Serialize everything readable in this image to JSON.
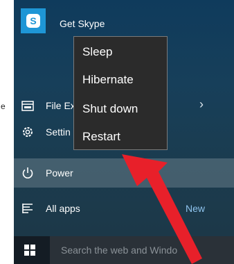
{
  "left_edge_text": "e",
  "start_menu": {
    "skype": {
      "icon_letter": "S",
      "label": "Get Skype"
    },
    "items": [
      {
        "key": "file_explorer",
        "label": "File Ex",
        "icon": "folder-icon"
      },
      {
        "key": "settings",
        "label": "Settin",
        "icon": "gear-icon"
      },
      {
        "key": "power",
        "label": "Power",
        "icon": "power-icon"
      },
      {
        "key": "all_apps",
        "label": "All apps",
        "icon": "list-icon",
        "badge": "New"
      }
    ],
    "file_explorer_chevron": "›"
  },
  "power_menu": {
    "items": [
      "Sleep",
      "Hibernate",
      "Shut down",
      "Restart"
    ]
  },
  "taskbar": {
    "search_placeholder": "Search the web and Windo"
  },
  "annotation": {
    "arrow_color": "#e8202a",
    "target": "Restart"
  },
  "colors": {
    "skype_blue": "#1e96d6",
    "accent_link": "#8fc4ee"
  }
}
